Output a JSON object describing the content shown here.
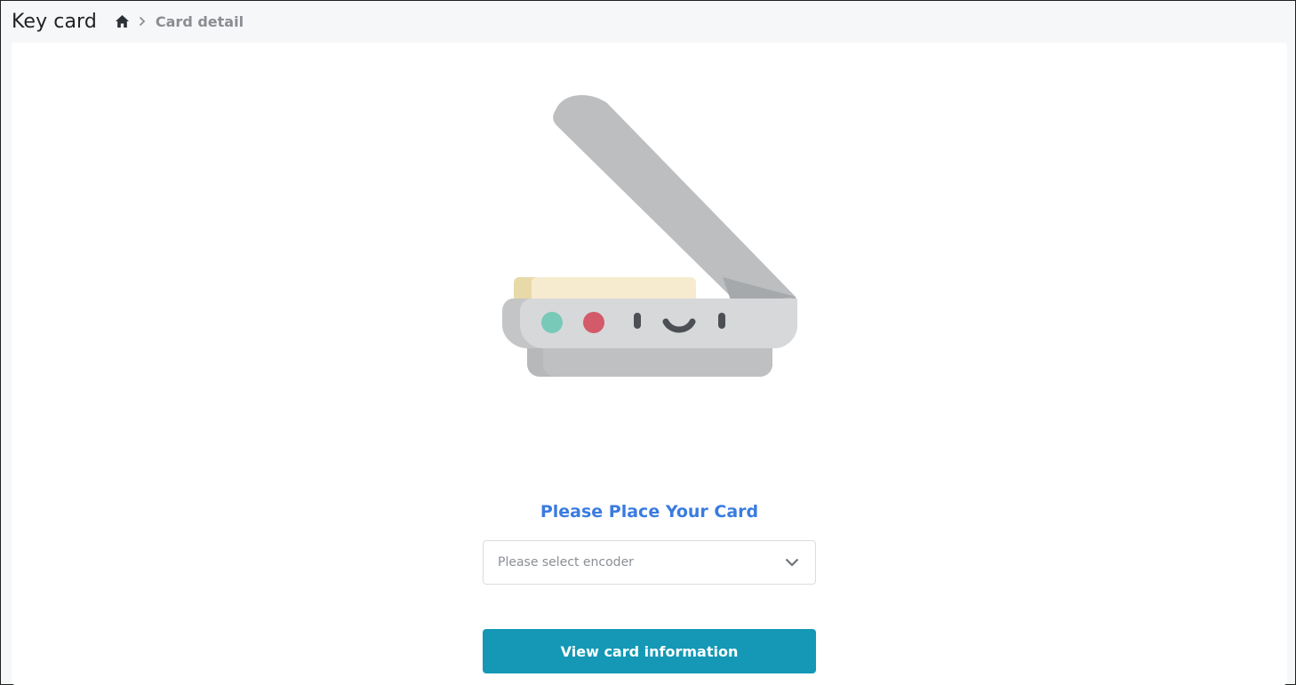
{
  "header": {
    "title": "Key card",
    "breadcrumb": {
      "home_icon": "home-icon",
      "separator_icon": "chevron-right-icon",
      "current": "Card detail"
    }
  },
  "main": {
    "illustration": "card-scanner-illustration",
    "prompt": "Please Place Your Card",
    "encoder_select": {
      "placeholder": "Please select encoder",
      "icon": "chevron-down-icon"
    },
    "view_button_label": "View card information"
  },
  "colors": {
    "accent_text": "#3a7be0",
    "button": "#1498b5",
    "background": "#f6f7f9"
  }
}
